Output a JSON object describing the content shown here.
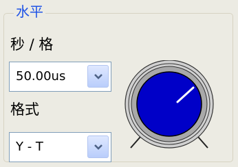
{
  "group": {
    "title": "水平"
  },
  "time_per_div": {
    "label": "秒 / 格",
    "selected": "50.00us"
  },
  "format": {
    "label": "格式",
    "selected": "Y - T"
  },
  "colors": {
    "accent": "#1f53e6",
    "knob_face": "#0000c8",
    "ring": "#a9a9a9"
  },
  "icons": {
    "dropdown": "chevron-down-icon"
  }
}
